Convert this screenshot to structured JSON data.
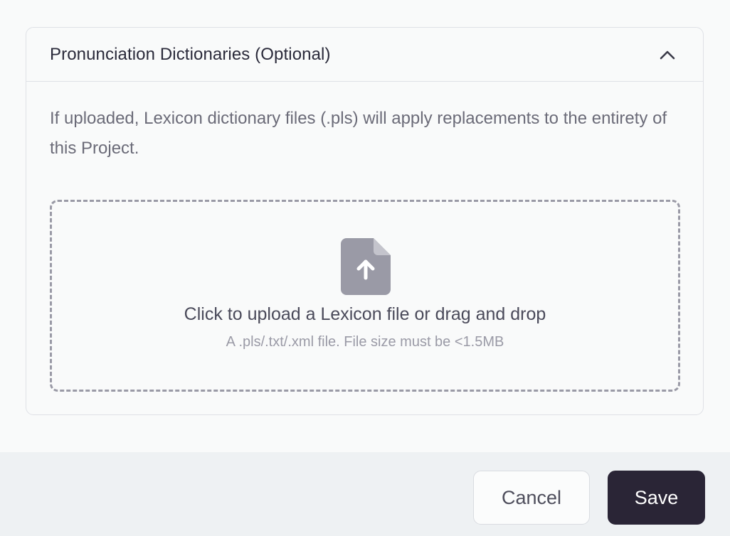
{
  "panel": {
    "title": "Pronunciation Dictionaries (Optional)",
    "collapse_icon": "chevron-up-icon",
    "description": "If uploaded, Lexicon dictionary files (.pls) will apply replacements to the entirety of this Project."
  },
  "dropzone": {
    "icon": "file-upload-icon",
    "title": "Click to upload a Lexicon file or drag and drop",
    "hint": "A .pls/.txt/.xml file. File size must be <1.5MB"
  },
  "footer": {
    "cancel_label": "Cancel",
    "save_label": "Save"
  },
  "colors": {
    "primary_button": "#2a2536",
    "icon_gray": "#9a9aa6",
    "border": "#dfe1e6"
  }
}
